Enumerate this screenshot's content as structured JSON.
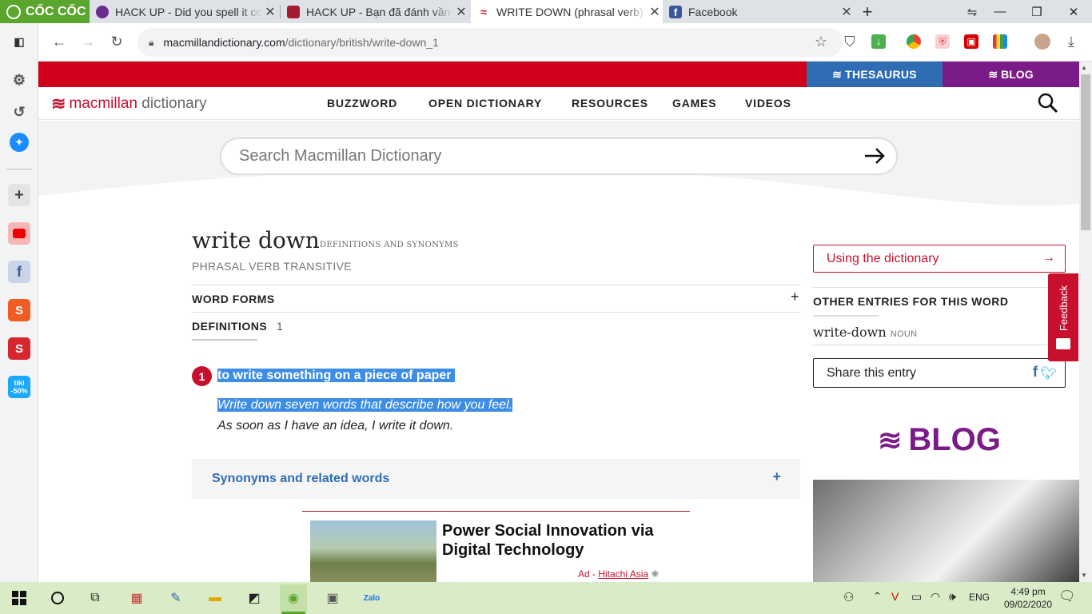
{
  "browser": {
    "app_name": "CỐC CỐC",
    "tabs": [
      {
        "title": "HACK UP - Did you spell it co",
        "favicon": "hackup-icon",
        "color": "#6a2c91"
      },
      {
        "title": "HACK UP - Bạn đã đánh vần c",
        "favicon": "harvard-icon",
        "color": "#a51c30"
      },
      {
        "title": "WRITE DOWN (phrasal verb) d",
        "favicon": "macmillan-icon",
        "color": "#c8102e"
      },
      {
        "title": "Facebook",
        "favicon": "facebook-icon",
        "color": "#3b5998"
      }
    ],
    "new_tab": "+",
    "url_host": "macmillandictionary.com",
    "url_path": "/dictionary/british/write-down_1"
  },
  "site": {
    "top_thesaurus": "THESAURUS",
    "top_blog": "BLOG",
    "logo_brand": "macmillan",
    "logo_word": "dictionary",
    "menu": [
      "BUZZWORD",
      "OPEN DICTIONARY",
      "RESOURCES",
      "GAMES",
      "VIDEOS"
    ],
    "search_placeholder": "Search Macmillan Dictionary"
  },
  "entry": {
    "headword": "write down",
    "subtitle": "DEFINITIONS AND SYNONYMS",
    "pos": "PHRASAL VERB  TRANSITIVE",
    "word_forms": "WORD FORMS",
    "word_forms_toggle": "+",
    "definitions": "DEFINITIONS",
    "definitions_count": "1",
    "sense_number": "1",
    "definition": "to write something on a piece of paper",
    "example1": "Write down seven words that describe how you feel.",
    "example2": "As soon as I have an idea, I write it down.",
    "synonyms": "Synonyms and related words",
    "synonyms_toggle": "+"
  },
  "ad": {
    "title": "Power Social Innovation via Digital Technology",
    "label": "Ad - ",
    "advertiser": "Hitachi Asia"
  },
  "sidebar": {
    "using": "Using the dictionary",
    "using_arrow": "→",
    "other_entries": "OTHER ENTRIES FOR THIS WORD",
    "other_word": "write-down",
    "other_pos": "NOUN",
    "share": "Share this entry",
    "blog": "BLOG",
    "feedback": "Feedback"
  },
  "taskbar": {
    "lang": "ENG",
    "time": "4:49 pm",
    "date": "09/02/2020"
  },
  "colors": {
    "red": "#d0021b",
    "thesaurus_blue": "#2e6db4",
    "blog_purple": "#7b1b87"
  }
}
